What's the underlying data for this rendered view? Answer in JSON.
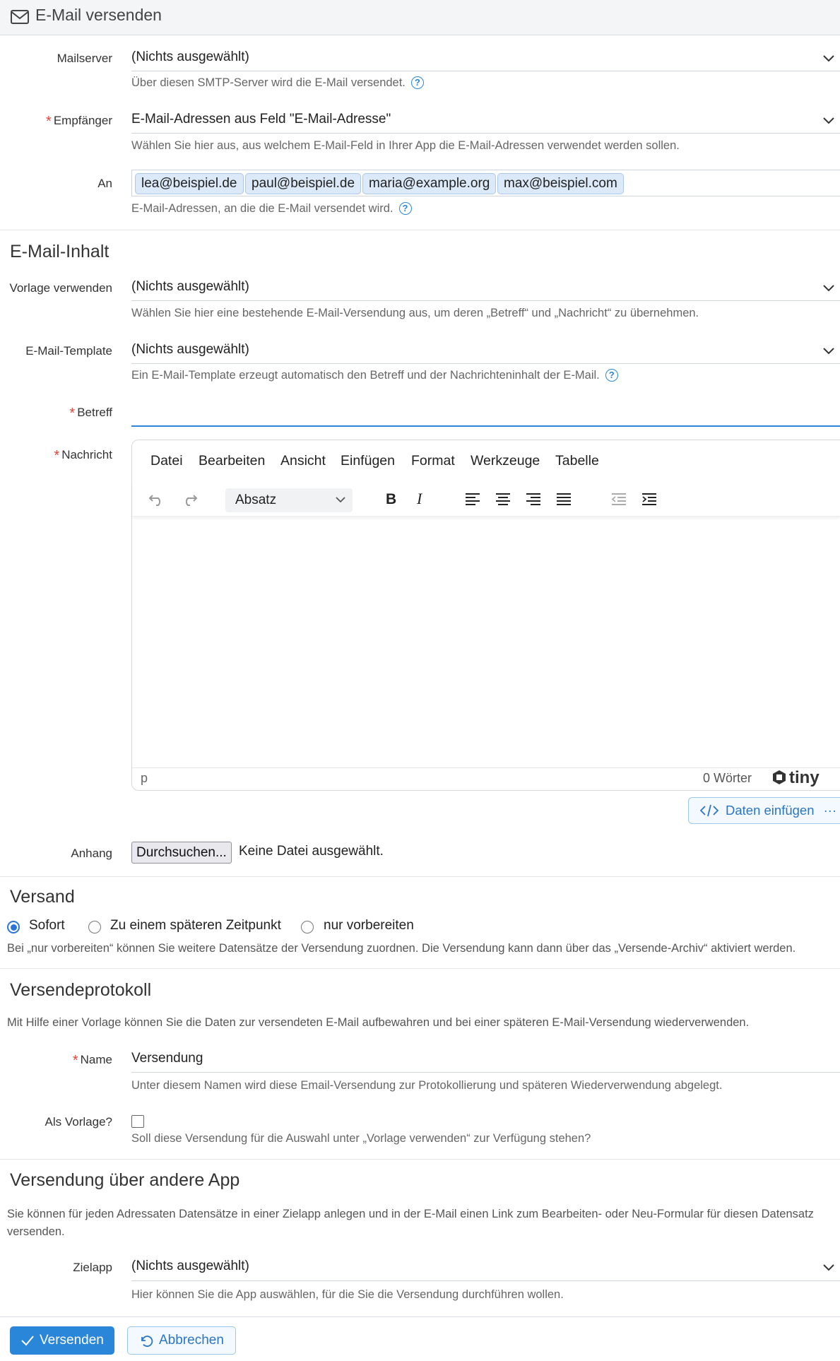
{
  "window": {
    "title": "E-Mail versenden"
  },
  "mailserver": {
    "label": "Mailserver",
    "value": "(Nichts ausgewählt)",
    "hint": "Über diesen SMTP-Server wird die E-Mail versendet."
  },
  "empfaenger": {
    "label": "Empfänger",
    "value": "E-Mail-Adressen aus Feld \"E-Mail-Adresse\"",
    "hint": "Wählen Sie hier aus, aus welchem E-Mail-Feld in Ihrer App die E-Mail-Adressen verwendet werden sollen."
  },
  "an": {
    "label": "An",
    "tags": [
      "lea@beispiel.de",
      "paul@beispiel.de",
      "maria@example.org",
      "max@beispiel.com"
    ],
    "hint": "E-Mail-Adressen, an die die E-Mail versendet wird."
  },
  "inhalt": {
    "heading": "E-Mail-Inhalt",
    "vorlage": {
      "label": "Vorlage verwenden",
      "value": "(Nichts ausgewählt)",
      "hint": "Wählen Sie hier eine bestehende E-Mail-Versendung aus, um deren „Betreff“ und „Nachricht“ zu übernehmen."
    },
    "template": {
      "label": "E-Mail-Template",
      "value": "(Nichts ausgewählt)",
      "hint": "Ein E-Mail-Template erzeugt automatisch den Betreff und der Nachrichteninhalt der E-Mail."
    },
    "betreff": {
      "label": "Betreff",
      "value": ""
    },
    "nachricht": {
      "label": "Nachricht"
    }
  },
  "editor": {
    "menu": [
      "Datei",
      "Bearbeiten",
      "Ansicht",
      "Einfügen",
      "Format",
      "Werkzeuge",
      "Tabelle"
    ],
    "block_format": "Absatz",
    "status_path": "p",
    "word_count": "0 Wörter",
    "brand": "tiny",
    "data_button": "Daten einfügen",
    "data_button_more": "···"
  },
  "anhang": {
    "label": "Anhang",
    "button": "Durchsuchen...",
    "status": "Keine Datei ausgewählt."
  },
  "versand": {
    "heading": "Versand",
    "options": [
      "Sofort",
      "Zu einem späteren Zeitpunkt",
      "nur vorbereiten"
    ],
    "selected": "Sofort",
    "hint": "Bei „nur vorbereiten“ können Sie weitere Datensätze der Versendung zuordnen. Die Versendung kann dann über das „Versende-Archiv“ aktiviert werden."
  },
  "protokoll": {
    "heading": "Versendeprotokoll",
    "intro": "Mit Hilfe einer Vorlage können Sie die Daten zur versendeten E-Mail aufbewahren und bei einer späteren E-Mail-Versendung wiederverwenden.",
    "name": {
      "label": "Name",
      "value": "Versendung",
      "hint": "Unter diesem Namen wird diese Email-Versendung zur Protokollierung und späteren Wiederverwendung abgelegt."
    },
    "vorlage": {
      "label": "Als Vorlage?",
      "checked": false,
      "hint": "Soll diese Versendung für die Auswahl unter „Vorlage verwenden“ zur Verfügung stehen?"
    }
  },
  "andereApp": {
    "heading": "Versendung über andere App",
    "intro": "Sie können für jeden Adressaten Datensätze in einer Zielapp anlegen und in der E-Mail einen Link zum Bearbeiten- oder Neu-Formular für diesen Datensatz versenden.",
    "zielapp": {
      "label": "Zielapp",
      "value": "(Nichts ausgewählt)",
      "hint": "Hier können Sie die App auswählen, für die Sie die Versendung durchführen wollen."
    }
  },
  "actions": {
    "send": "Versenden",
    "cancel": "Abbrechen"
  },
  "colors": {
    "accent": "#2a86d8",
    "required": "#e0453a",
    "tag_bg": "#dbe9f8"
  }
}
